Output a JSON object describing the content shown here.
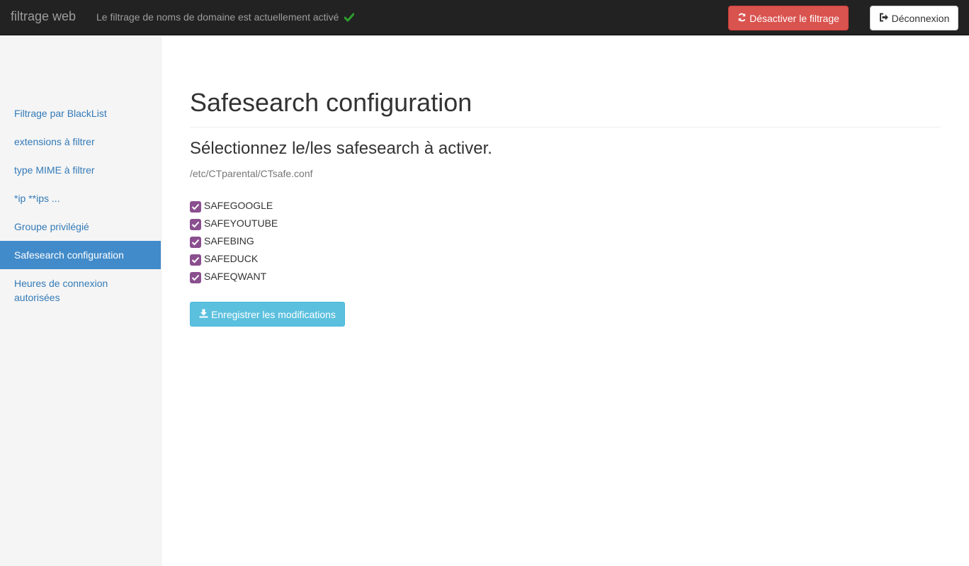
{
  "navbar": {
    "brand": "filtrage web",
    "status_text": "Le filtrage de noms de domaine est actuellement activé",
    "status_icon": "check-icon",
    "disable_button": "Désactiver le filtrage",
    "logout_button": "Déconnexion"
  },
  "sidebar": {
    "items": [
      {
        "label": "Filtrage par BlackList"
      },
      {
        "label": "extensions à filtrer"
      },
      {
        "label": "type MIME à filtrer"
      },
      {
        "label": "*ip **ips ..."
      },
      {
        "label": "Groupe privilégié"
      },
      {
        "label": "Safesearch configuration"
      },
      {
        "label": "Heures de connexion autorisées"
      }
    ],
    "active_index": 5
  },
  "main": {
    "title": "Safesearch configuration",
    "subtitle": "Sélectionnez le/les safesearch à activer.",
    "filepath": "/etc/CTparental/CTsafe.conf",
    "options": [
      {
        "label": "SAFEGOOGLE",
        "checked": true
      },
      {
        "label": "SAFEYOUTUBE",
        "checked": true
      },
      {
        "label": "SAFEBING",
        "checked": true
      },
      {
        "label": "SAFEDUCK",
        "checked": true
      },
      {
        "label": "SAFEQWANT",
        "checked": true
      }
    ],
    "save_button": "Enregistrer les modifications"
  },
  "colors": {
    "navbar_bg": "#222222",
    "danger": "#d9534f",
    "info": "#5bc0de",
    "active_nav": "#428bca",
    "link": "#337ab7",
    "checkbox": "#8a4f8f",
    "success": "#2ca02c"
  }
}
